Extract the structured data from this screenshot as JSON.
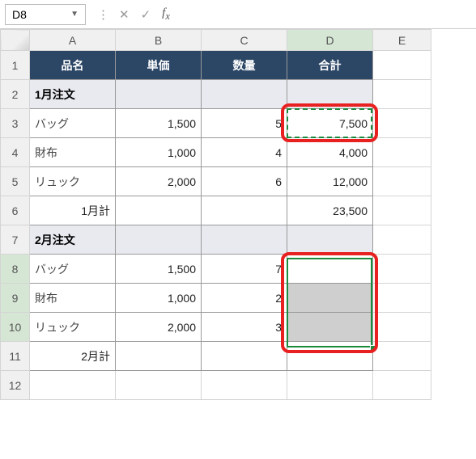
{
  "nameBox": "D8",
  "formula": "",
  "columns": [
    "A",
    "B",
    "C",
    "D",
    "E"
  ],
  "rowCount": 12,
  "selectedCol": "D",
  "selectedRows": [
    8,
    9,
    10
  ],
  "headerRow": {
    "a": "品名",
    "b": "単価",
    "c": "数量",
    "d": "合計"
  },
  "rows": {
    "2": {
      "a": "1月注文"
    },
    "3": {
      "a": "バッグ",
      "b": "1,500",
      "c": "5",
      "d": "7,500"
    },
    "4": {
      "a": "財布",
      "b": "1,000",
      "c": "4",
      "d": "4,000"
    },
    "5": {
      "a": "リュック",
      "b": "2,000",
      "c": "6",
      "d": "12,000"
    },
    "6": {
      "a": "1月計",
      "d": "23,500"
    },
    "7": {
      "a": "2月注文"
    },
    "8": {
      "a": "バッグ",
      "b": "1,500",
      "c": "7"
    },
    "9": {
      "a": "財布",
      "b": "1,000",
      "c": "2"
    },
    "10": {
      "a": "リュック",
      "b": "2,000",
      "c": "3"
    },
    "11": {
      "a": "2月計"
    }
  },
  "chart_data": null
}
